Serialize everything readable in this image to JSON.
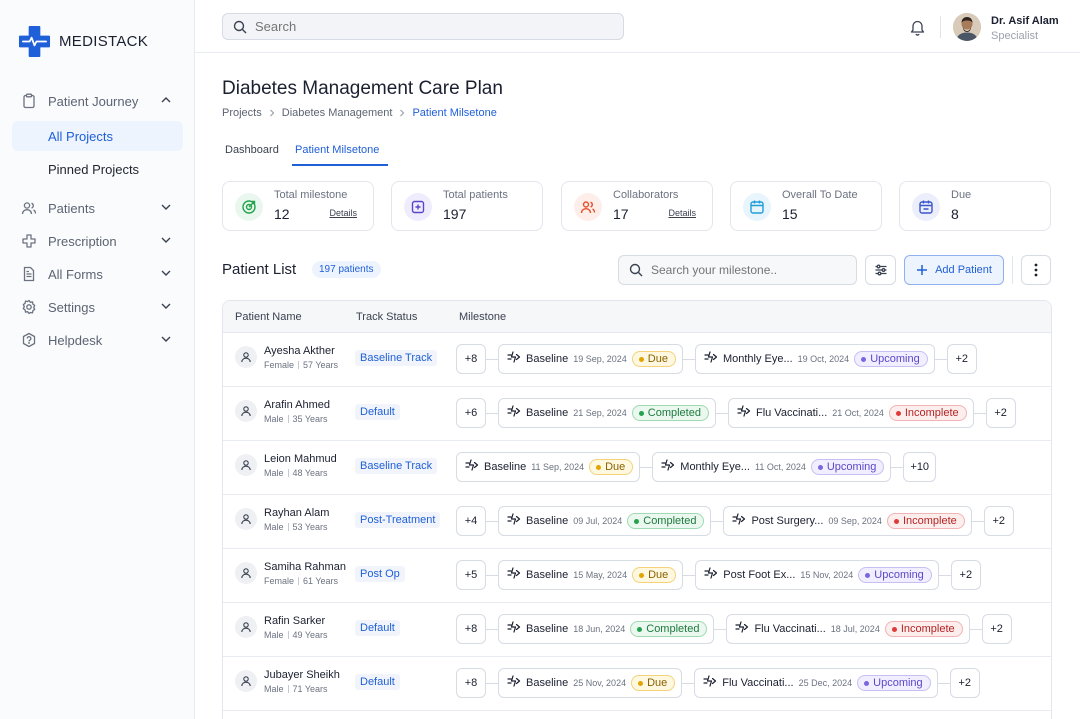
{
  "brand": {
    "name": "MEDISTACK"
  },
  "sidebar": {
    "items": [
      {
        "label": "Patient Journey",
        "icon": "clipboard-icon",
        "expanded": true
      },
      {
        "label": "Patients",
        "icon": "users-icon"
      },
      {
        "label": "Prescription",
        "icon": "medical-cross-icon"
      },
      {
        "label": "All Forms",
        "icon": "document-icon"
      },
      {
        "label": "Settings",
        "icon": "gear-icon"
      },
      {
        "label": "Helpdesk",
        "icon": "help-icon"
      }
    ],
    "sub_items": [
      {
        "label": "All Projects",
        "active": true
      },
      {
        "label": "Pinned Projects",
        "active": false
      }
    ]
  },
  "topbar": {
    "search_placeholder": "Search",
    "user_name": "Dr. Asif Alam",
    "user_role": "Specialist"
  },
  "page": {
    "title": "Diabetes Management Care Plan",
    "breadcrumbs": [
      "Projects",
      "Diabetes Management",
      "Patient Milsetone"
    ],
    "tabs": [
      {
        "label": "Dashboard",
        "active": false
      },
      {
        "label": "Patient Milsetone",
        "active": true
      }
    ]
  },
  "stats": [
    {
      "label": "Total milestone",
      "value": "12",
      "details": "Details",
      "color": "#22a34c",
      "bg": "#eaf7ee"
    },
    {
      "label": "Total patients",
      "value": "197",
      "details": "",
      "color": "#5b47c8",
      "bg": "#efedfd"
    },
    {
      "label": "Collaborators",
      "value": "17",
      "details": "Details",
      "color": "#e5532f",
      "bg": "#fdeee9"
    },
    {
      "label": "Overall To Date",
      "value": "15",
      "details": "",
      "color": "#1f9ed8",
      "bg": "#e8f5fc"
    },
    {
      "label": "Due",
      "value": "8",
      "details": "",
      "color": "#3a56c8",
      "bg": "#eceffb"
    }
  ],
  "patient_list": {
    "title": "Patient List",
    "count": "197 patients",
    "search_placeholder": "Search your milestone..",
    "add_label": "Add Patient",
    "columns": [
      "Patient Name",
      "Track Status",
      "Milestone"
    ],
    "rows": [
      {
        "name": "Ayesha Akther",
        "gender": "Female",
        "age": "57 Years",
        "track": "Baseline Track",
        "lead": "+8",
        "milestones": [
          {
            "name": "Baseline",
            "date": "19 Sep, 2024",
            "status": "Due",
            "kind": "due"
          },
          {
            "name": "Monthly Eye...",
            "date": "19 Oct, 2024",
            "status": "Upcoming",
            "kind": "upcoming"
          }
        ],
        "tail": "+2"
      },
      {
        "name": "Arafin Ahmed",
        "gender": "Male",
        "age": "35 Years",
        "track": "Default",
        "lead": "+6",
        "milestones": [
          {
            "name": "Baseline",
            "date": "21 Sep, 2024",
            "status": "Completed",
            "kind": "completed"
          },
          {
            "name": "Flu Vaccinati...",
            "date": "21 Oct, 2024",
            "status": "Incomplete",
            "kind": "incomplete"
          }
        ],
        "tail": "+2"
      },
      {
        "name": "Leion Mahmud",
        "gender": "Male",
        "age": "48 Years",
        "track": "Baseline Track",
        "lead": "",
        "milestones": [
          {
            "name": "Baseline",
            "date": "11 Sep, 2024",
            "status": "Due",
            "kind": "due"
          },
          {
            "name": "Monthly Eye...",
            "date": "11 Oct, 2024",
            "status": "Upcoming",
            "kind": "upcoming"
          }
        ],
        "tail": "+10"
      },
      {
        "name": "Rayhan Alam",
        "gender": "Male",
        "age": "53 Years",
        "track": "Post-Treatment",
        "lead": "+4",
        "milestones": [
          {
            "name": "Baseline",
            "date": "09 Jul, 2024",
            "status": "Completed",
            "kind": "completed"
          },
          {
            "name": "Post Surgery...",
            "date": "09 Sep, 2024",
            "status": "Incomplete",
            "kind": "incomplete"
          }
        ],
        "tail": "+2"
      },
      {
        "name": "Samiha Rahman",
        "gender": "Female",
        "age": "61 Years",
        "track": "Post Op",
        "lead": "+5",
        "milestones": [
          {
            "name": "Baseline",
            "date": "15 May, 2024",
            "status": "Due",
            "kind": "due"
          },
          {
            "name": "Post Foot Ex...",
            "date": "15 Nov, 2024",
            "status": "Upcoming",
            "kind": "upcoming"
          }
        ],
        "tail": "+2"
      },
      {
        "name": "Rafin Sarker",
        "gender": "Male",
        "age": "49 Years",
        "track": "Default",
        "lead": "+8",
        "milestones": [
          {
            "name": "Baseline",
            "date": "18 Jun, 2024",
            "status": "Completed",
            "kind": "completed"
          },
          {
            "name": "Flu Vaccinati...",
            "date": "18 Jul, 2024",
            "status": "Incomplete",
            "kind": "incomplete"
          }
        ],
        "tail": "+2"
      },
      {
        "name": "Jubayer Sheikh",
        "gender": "Male",
        "age": "71 Years",
        "track": "Default",
        "lead": "+8",
        "milestones": [
          {
            "name": "Baseline",
            "date": "25 Nov, 2024",
            "status": "Due",
            "kind": "due"
          },
          {
            "name": "Flu Vaccinati...",
            "date": "25 Dec, 2024",
            "status": "Upcoming",
            "kind": "upcoming"
          }
        ],
        "tail": "+2"
      }
    ]
  }
}
